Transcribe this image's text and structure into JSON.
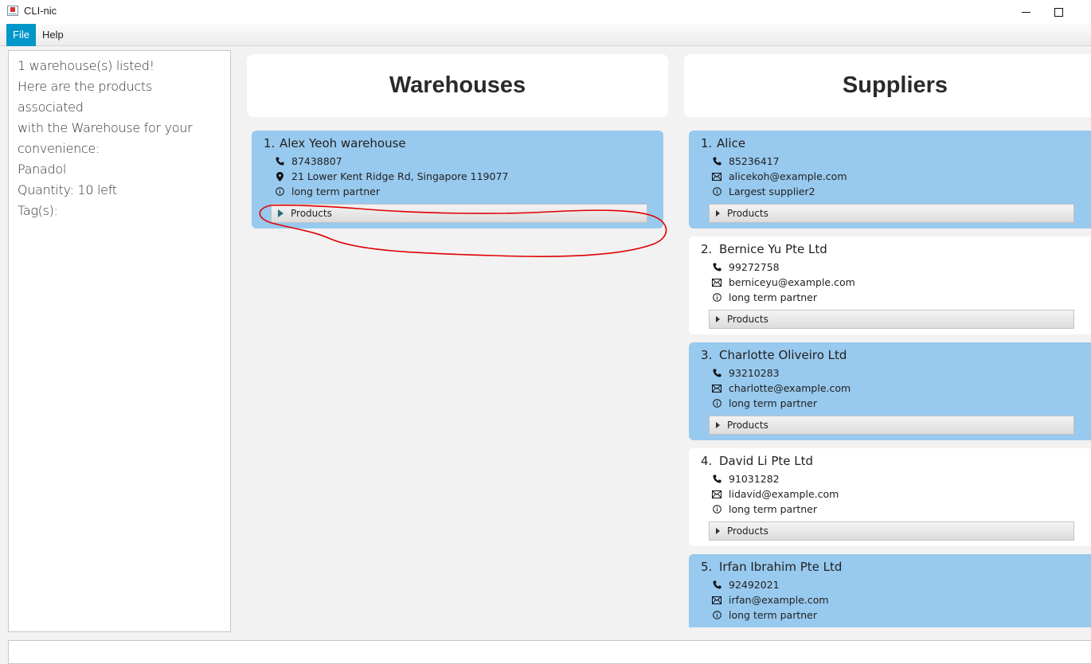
{
  "window": {
    "title": "CLI-nic"
  },
  "menu": {
    "file": "File",
    "help": "Help"
  },
  "result": {
    "lines": [
      "1 warehouse(s) listed!",
      "",
      "Here are the products associated",
      "with the Warehouse for your",
      "convenience:",
      "",
      "Panadol",
      "Quantity: 10 left",
      "Tag(s):"
    ]
  },
  "warehouses": {
    "header": "Warehouses",
    "items": [
      {
        "index": "1.",
        "name": "Alex Yeoh warehouse",
        "phone": "87438807",
        "address": "21 Lower Kent Ridge Rd, Singapore 119077",
        "remark": "long term partner",
        "products_label": "Products"
      }
    ]
  },
  "suppliers": {
    "header": "Suppliers",
    "items": [
      {
        "index": "1.",
        "name": "Alice",
        "phone": "85236417",
        "email": "alicekoh@example.com",
        "remark": "Largest supplier2",
        "products_label": "Products"
      },
      {
        "index": "2.",
        "name": "Bernice Yu Pte Ltd",
        "phone": "99272758",
        "email": "berniceyu@example.com",
        "remark": "long term partner",
        "products_label": "Products"
      },
      {
        "index": "3.",
        "name": "Charlotte Oliveiro Ltd",
        "phone": "93210283",
        "email": "charlotte@example.com",
        "remark": "long term partner",
        "products_label": "Products"
      },
      {
        "index": "4.",
        "name": "David Li Pte Ltd",
        "phone": "91031282",
        "email": "lidavid@example.com",
        "remark": "long term partner",
        "products_label": "Products"
      },
      {
        "index": "5.",
        "name": "Irfan Ibrahim Pte Ltd",
        "phone": "92492021",
        "email": "irfan@example.com",
        "remark": "long term partner"
      }
    ]
  },
  "command": {
    "value": ""
  },
  "colors": {
    "card_selected": "#98c9ee",
    "card_plain": "#ffffff",
    "menu_active": "#0096c9",
    "annotation": "#e00000"
  },
  "icons": {
    "phone": "phone-icon",
    "address": "location-pin-icon",
    "email": "mail-icon",
    "remark": "info-icon",
    "expand": "triangle-right-icon"
  }
}
